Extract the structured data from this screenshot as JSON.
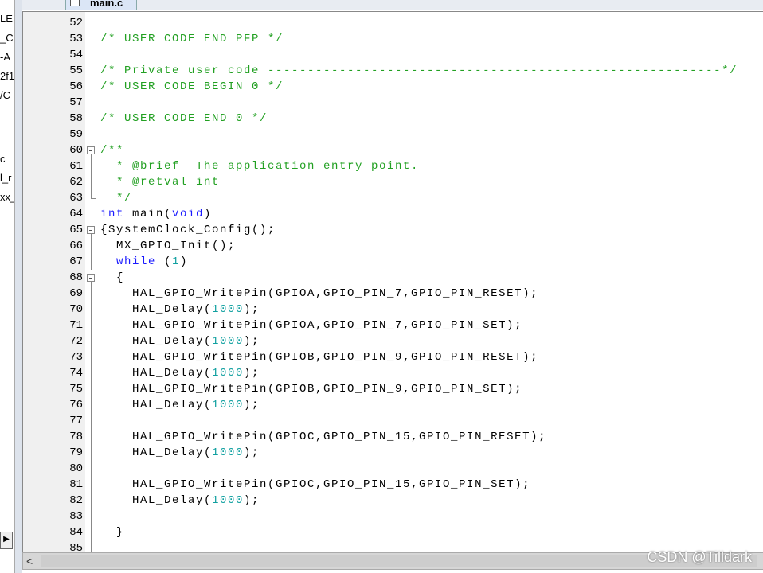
{
  "left_panel": {
    "items": [
      "LE",
      "_C(",
      "-A",
      "2f1",
      "/C",
      "c",
      "l_r",
      "xx_"
    ]
  },
  "tab": {
    "label": "main.c"
  },
  "watermark": "CSDN @Tilldark",
  "lines": [
    {
      "n": "52",
      "f": "",
      "t": []
    },
    {
      "n": "53",
      "f": "",
      "t": [
        [
          "/* USER CODE END PFP */",
          "comment"
        ]
      ]
    },
    {
      "n": "54",
      "f": "",
      "t": []
    },
    {
      "n": "55",
      "f": "",
      "t": [
        [
          "/* Private user code ---------------------------------------------------------*/",
          "comment"
        ]
      ]
    },
    {
      "n": "56",
      "f": "",
      "t": [
        [
          "/* USER CODE BEGIN 0 */",
          "comment"
        ]
      ]
    },
    {
      "n": "57",
      "f": "",
      "t": []
    },
    {
      "n": "58",
      "f": "",
      "t": [
        [
          "/* USER CODE END 0 */",
          "comment"
        ]
      ]
    },
    {
      "n": "59",
      "f": "",
      "t": []
    },
    {
      "n": "60",
      "f": "box",
      "t": [
        [
          "/**",
          "comment"
        ]
      ]
    },
    {
      "n": "61",
      "f": "line",
      "t": [
        [
          "  * @brief  The application entry point.",
          "comment"
        ]
      ]
    },
    {
      "n": "62",
      "f": "line",
      "t": [
        [
          "  * @retval int",
          "comment"
        ]
      ]
    },
    {
      "n": "63",
      "f": "end",
      "t": [
        [
          "  */",
          "comment"
        ]
      ]
    },
    {
      "n": "64",
      "f": "",
      "t": [
        [
          "int",
          "kw"
        ],
        [
          " main(",
          "plain"
        ],
        [
          "void",
          "kw"
        ],
        [
          ")",
          "plain"
        ]
      ]
    },
    {
      "n": "65",
      "f": "box",
      "t": [
        [
          "{SystemClock_Config();",
          "plain"
        ]
      ]
    },
    {
      "n": "66",
      "f": "line",
      "t": [
        [
          "  MX_GPIO_Init();",
          "plain"
        ]
      ]
    },
    {
      "n": "67",
      "f": "line",
      "t": [
        [
          "  ",
          "plain"
        ],
        [
          "while",
          "kw"
        ],
        [
          " (",
          "plain"
        ],
        [
          "1",
          "num"
        ],
        [
          ")",
          "plain"
        ]
      ]
    },
    {
      "n": "68",
      "f": "box",
      "t": [
        [
          "  {",
          "plain"
        ]
      ]
    },
    {
      "n": "69",
      "f": "line",
      "t": [
        [
          "    HAL_GPIO_WritePin(GPIOA,GPIO_PIN_7,GPIO_PIN_RESET);",
          "plain"
        ]
      ]
    },
    {
      "n": "70",
      "f": "line",
      "t": [
        [
          "    HAL_Delay(",
          "plain"
        ],
        [
          "1000",
          "num"
        ],
        [
          ");",
          "plain"
        ]
      ]
    },
    {
      "n": "71",
      "f": "line",
      "t": [
        [
          "    HAL_GPIO_WritePin(GPIOA,GPIO_PIN_7,GPIO_PIN_SET);",
          "plain"
        ]
      ]
    },
    {
      "n": "72",
      "f": "line",
      "t": [
        [
          "    HAL_Delay(",
          "plain"
        ],
        [
          "1000",
          "num"
        ],
        [
          ");",
          "plain"
        ]
      ]
    },
    {
      "n": "73",
      "f": "line",
      "t": [
        [
          "    HAL_GPIO_WritePin(GPIOB,GPIO_PIN_9,GPIO_PIN_RESET);",
          "plain"
        ]
      ]
    },
    {
      "n": "74",
      "f": "line",
      "t": [
        [
          "    HAL_Delay(",
          "plain"
        ],
        [
          "1000",
          "num"
        ],
        [
          ");",
          "plain"
        ]
      ]
    },
    {
      "n": "75",
      "f": "line",
      "t": [
        [
          "    HAL_GPIO_WritePin(GPIOB,GPIO_PIN_9,GPIO_PIN_SET);",
          "plain"
        ]
      ]
    },
    {
      "n": "76",
      "f": "line",
      "t": [
        [
          "    HAL_Delay(",
          "plain"
        ],
        [
          "1000",
          "num"
        ],
        [
          ");",
          "plain"
        ]
      ]
    },
    {
      "n": "77",
      "f": "line",
      "t": []
    },
    {
      "n": "78",
      "f": "line",
      "t": [
        [
          "    HAL_GPIO_WritePin(GPIOC,GPIO_PIN_15,GPIO_PIN_RESET);",
          "plain"
        ]
      ]
    },
    {
      "n": "79",
      "f": "line",
      "t": [
        [
          "    HAL_Delay(",
          "plain"
        ],
        [
          "1000",
          "num"
        ],
        [
          ");",
          "plain"
        ]
      ]
    },
    {
      "n": "80",
      "f": "line",
      "t": []
    },
    {
      "n": "81",
      "f": "line",
      "t": [
        [
          "    HAL_GPIO_WritePin(GPIOC,GPIO_PIN_15,GPIO_PIN_SET);",
          "plain"
        ]
      ]
    },
    {
      "n": "82",
      "f": "line",
      "t": [
        [
          "    HAL_Delay(",
          "plain"
        ],
        [
          "1000",
          "num"
        ],
        [
          ");",
          "plain"
        ]
      ]
    },
    {
      "n": "83",
      "f": "line",
      "t": []
    },
    {
      "n": "84",
      "f": "line",
      "t": [
        [
          "  }",
          "plain"
        ]
      ]
    },
    {
      "n": "85",
      "f": "line",
      "t": []
    }
  ]
}
